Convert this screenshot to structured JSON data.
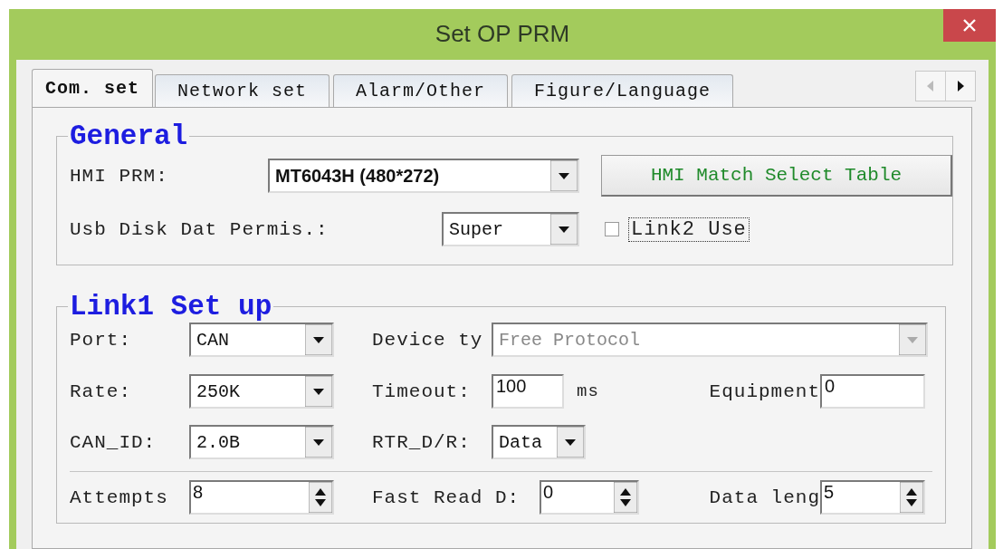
{
  "window": {
    "title": "Set OP PRM"
  },
  "tabs": [
    {
      "label": "Com. set",
      "selected": true
    },
    {
      "label": "Network set",
      "selected": false
    },
    {
      "label": "Alarm/Other",
      "selected": false
    },
    {
      "label": "Figure/Language",
      "selected": false
    }
  ],
  "tab_scroll": {
    "left_disabled": true,
    "right_disabled": false
  },
  "general": {
    "title": "General",
    "hmi_prm": {
      "label": "HMI PRM:",
      "value": "MT6043H (480*272)"
    },
    "match_button": "HMI Match Select Table",
    "usb_permission": {
      "label": "Usb Disk Dat Permis.:",
      "value": "Super"
    },
    "link2": {
      "label": "Link2 Use",
      "checked": false
    }
  },
  "link1": {
    "title": "Link1 Set up",
    "rows": [
      [
        {
          "kind": "dropdown",
          "label": "Port:",
          "value": "CAN",
          "disabled": false
        },
        {
          "kind": "dropdown",
          "label": "Device ty",
          "value": "Free Protocol",
          "disabled": true
        }
      ],
      [
        {
          "kind": "dropdown",
          "label": "Rate:",
          "value": "250K",
          "disabled": false
        },
        {
          "kind": "text",
          "label": "Timeout:",
          "value": "100",
          "unit": "ms"
        },
        {
          "kind": "text",
          "label": "Equipment",
          "value": "0"
        }
      ],
      [
        {
          "kind": "dropdown",
          "label": "CAN_ID:",
          "value": "2.0B",
          "disabled": false
        },
        {
          "kind": "dropdown",
          "label": "RTR_D/R:",
          "value": "Data",
          "disabled": false
        }
      ],
      [
        {
          "kind": "spinner",
          "label": "Attempts",
          "value": "8"
        },
        {
          "kind": "spinner",
          "label": "Fast Read D:",
          "value": "0"
        },
        {
          "kind": "spinner",
          "label": "Data leng",
          "value": "5"
        }
      ]
    ]
  }
}
